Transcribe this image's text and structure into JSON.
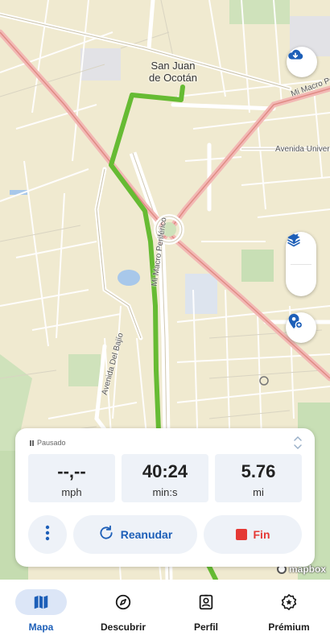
{
  "map": {
    "place_label": "San Juan\nde Ocotán",
    "roads": {
      "mi_macro_periferico_top": "Mi Macro Periférico",
      "mi_macro_periferico": "Mi Macro Periférico",
      "avenida_universidad": "Avenida Universi",
      "avenida_del_bajio": "Avenida Del Bajío"
    },
    "attribution": "mapbox"
  },
  "controls": {
    "download_icon": "cloud-download-icon",
    "layers_icon": "layers-icon",
    "locate_icon": "navigation-arrow-icon",
    "poi_icon": "add-location-icon"
  },
  "tracking": {
    "status": "Pausado",
    "speed": {
      "value": "--,--",
      "unit": "mph"
    },
    "time": {
      "value": "40:24",
      "unit": "min:s"
    },
    "distance": {
      "value": "5.76",
      "unit": "mi"
    },
    "resume_label": "Reanudar",
    "end_label": "Fin"
  },
  "bottom_nav": {
    "items": [
      {
        "label": "Mapa",
        "icon": "map-icon",
        "active": true
      },
      {
        "label": "Descubrir",
        "icon": "compass-icon",
        "active": false
      },
      {
        "label": "Perfil",
        "icon": "profile-badge-icon",
        "active": false
      },
      {
        "label": "Prémium",
        "icon": "premium-badge-icon",
        "active": false
      }
    ]
  },
  "colors": {
    "accent": "#1d5fb8",
    "route": "#66bb33",
    "end_red": "#e53935",
    "map_bg": "#f0ead0"
  }
}
